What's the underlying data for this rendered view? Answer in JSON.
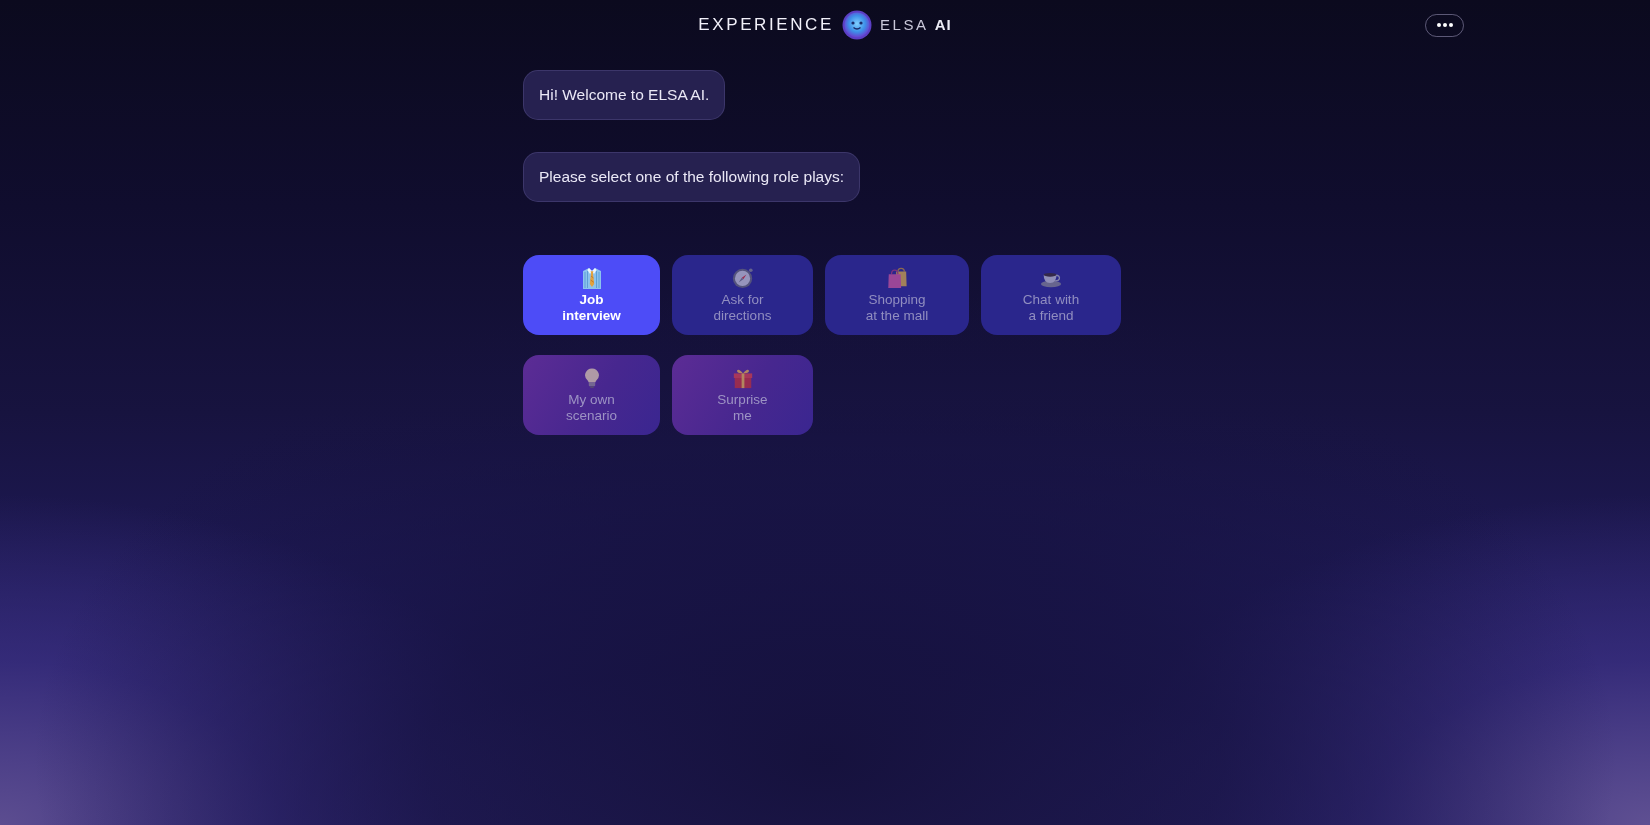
{
  "header": {
    "title": "EXPERIENCE",
    "brand": "ELSA **AI**"
  },
  "messages": [
    {
      "text": "Hi! Welcome to ELSA AI."
    },
    {
      "text": "Please select one of the following role plays:"
    }
  ],
  "role_plays": [
    {
      "kind": "preset",
      "label": "Job\ninterview",
      "selected": true
    },
    {
      "kind": "preset",
      "label": "Ask for\ndirections",
      "selected": false
    },
    {
      "kind": "preset",
      "label": "Shopping\nat the mall",
      "selected": false
    },
    {
      "kind": "preset",
      "label": "Chat with\na friend",
      "selected": false
    },
    {
      "kind": "custom",
      "label": "My own\nscenario",
      "selected": false
    },
    {
      "kind": "custom",
      "label": "Surprise\nme",
      "selected": false
    }
  ]
}
